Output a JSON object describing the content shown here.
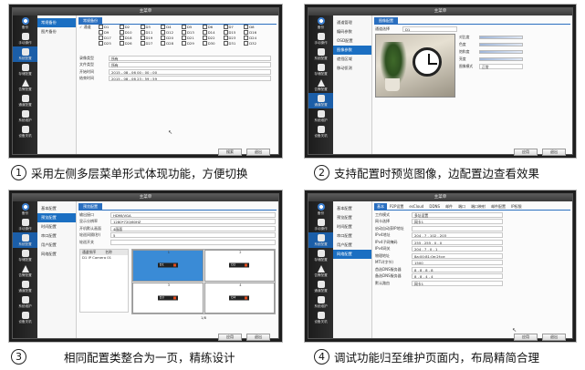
{
  "window_title": "主菜单",
  "sidebar": [
    {
      "label": "备份",
      "icon": "logo-icon"
    },
    {
      "label": "手动操作",
      "icon": "hand-icon"
    },
    {
      "label": "系统配置",
      "icon": "gear-icon"
    },
    {
      "label": "存储配置",
      "icon": "storage-icon"
    },
    {
      "label": "告警配置",
      "icon": "alarm-icon"
    },
    {
      "label": "通道配置",
      "icon": "camera-icon"
    },
    {
      "label": "系统维护",
      "icon": "maintenance-icon"
    },
    {
      "label": "设备关机",
      "icon": "power-icon"
    }
  ],
  "panel1": {
    "subnav": [
      "常规备份",
      "图片备份"
    ],
    "tab": "常规备份",
    "select_all": "通道",
    "channels": [
      "D1",
      "D2",
      "D3",
      "D4",
      "D5",
      "D6",
      "D7",
      "D8",
      "D9",
      "D10",
      "D11",
      "D12",
      "D13",
      "D14",
      "D15",
      "D16",
      "D17",
      "D18",
      "D19",
      "D20",
      "D21",
      "D22",
      "D23",
      "D24",
      "D25",
      "D26",
      "D27",
      "D28",
      "D29",
      "D30",
      "D31",
      "D32"
    ],
    "fields": [
      {
        "label": "录像类型",
        "value": "所有"
      },
      {
        "label": "文件类型",
        "value": "所有"
      },
      {
        "label": "开始时间",
        "value": "2015  -  08  -  06      00  :  00  :  00"
      },
      {
        "label": "结束时间",
        "value": "2015  -  08  -  06      23  :  59  :  59"
      }
    ],
    "search_btn": "搜索",
    "back_btn": "退出"
  },
  "panel2": {
    "subnav": [
      "通道管理",
      "编码参数",
      "OSD配置",
      "图像参数",
      "遮挡区域",
      "移动侦测"
    ],
    "active": "图像参数",
    "tab": "图像配置",
    "channel_label": "通道选择",
    "channel_value": "D1",
    "sliders": [
      "对比度",
      "色度",
      "饱和度",
      "亮度"
    ],
    "mode_label": "图像模式",
    "mode_value": "正常",
    "ok_btn": "应用",
    "back_btn": "退出"
  },
  "panel3": {
    "subnav": [
      "基本配置",
      "预览配置",
      "时间配置",
      "串口配置",
      "用户配置",
      "网络配置"
    ],
    "active": "预览配置",
    "tab": "预览配置",
    "fields": [
      {
        "label": "输出接口",
        "value": "HDMI/VGA"
      },
      {
        "label": "显示分辨率",
        "value": "1280*720/60HZ"
      },
      {
        "label": "开机默认画面",
        "value": "4画面"
      },
      {
        "label": "轮巡间隔(秒)",
        "value": "5"
      },
      {
        "label": "轮巡开关",
        "value": ""
      }
    ],
    "list_head": [
      "通道排序",
      "名称"
    ],
    "list_rows": [
      "D1   IP Camera 01"
    ],
    "cells": [
      {
        "num": "1",
        "chip": "D1"
      },
      {
        "num": "2",
        "chip": "D2"
      },
      {
        "num": "3",
        "chip": "D3"
      },
      {
        "num": "4",
        "chip": "D4"
      }
    ],
    "pager": "1/8",
    "ok_btn": "应用",
    "back_btn": "退出"
  },
  "panel4": {
    "subnav": [
      "基本配置",
      "预览配置",
      "时间配置",
      "串口配置",
      "用户配置",
      "网络配置"
    ],
    "active": "网络配置",
    "tabs": [
      "基本",
      "P2P设置",
      "esCloud",
      "DDNS",
      "邮件",
      "端口",
      "端口映射",
      "邮件配置",
      "IP权限"
    ],
    "fields": [
      {
        "label": "工作模式",
        "value": "多址设置"
      },
      {
        "label": "网卡选择",
        "value": "网卡1"
      },
      {
        "label": "启动自动获IP地址",
        "value": ""
      },
      {
        "label": "IPv4地址",
        "value": "204 . 7 . 102 . 203"
      },
      {
        "label": "IPv4子网掩码",
        "value": "255 . 255 . 0 . 0"
      },
      {
        "label": "IPv4网关",
        "value": "204 . 7 . 0 . 1"
      },
      {
        "label": "物理地址",
        "value": "8a:00:81:0e:2f:ce"
      },
      {
        "label": "MTU(字节)",
        "value": "1500"
      },
      {
        "label": "首选DNS服务器",
        "value": "8 . 8 . 8 . 8"
      },
      {
        "label": "备选DNS服务器",
        "value": "8 . 8 . 4 . 4"
      },
      {
        "label": "默认路由",
        "value": "网卡1"
      }
    ],
    "ok_btn": "应用",
    "back_btn": "退出"
  },
  "captions": [
    {
      "num": "1",
      "text": "采用左侧多层菜单形式体现功能，方便切换"
    },
    {
      "num": "2",
      "text": "支持配置时预览图像，边配置边查看效果"
    },
    {
      "num": "3",
      "text": "相同配置类整合为一页，精练设计"
    },
    {
      "num": "4",
      "text": "调试功能归至维护页面内，布局精简合理"
    }
  ]
}
